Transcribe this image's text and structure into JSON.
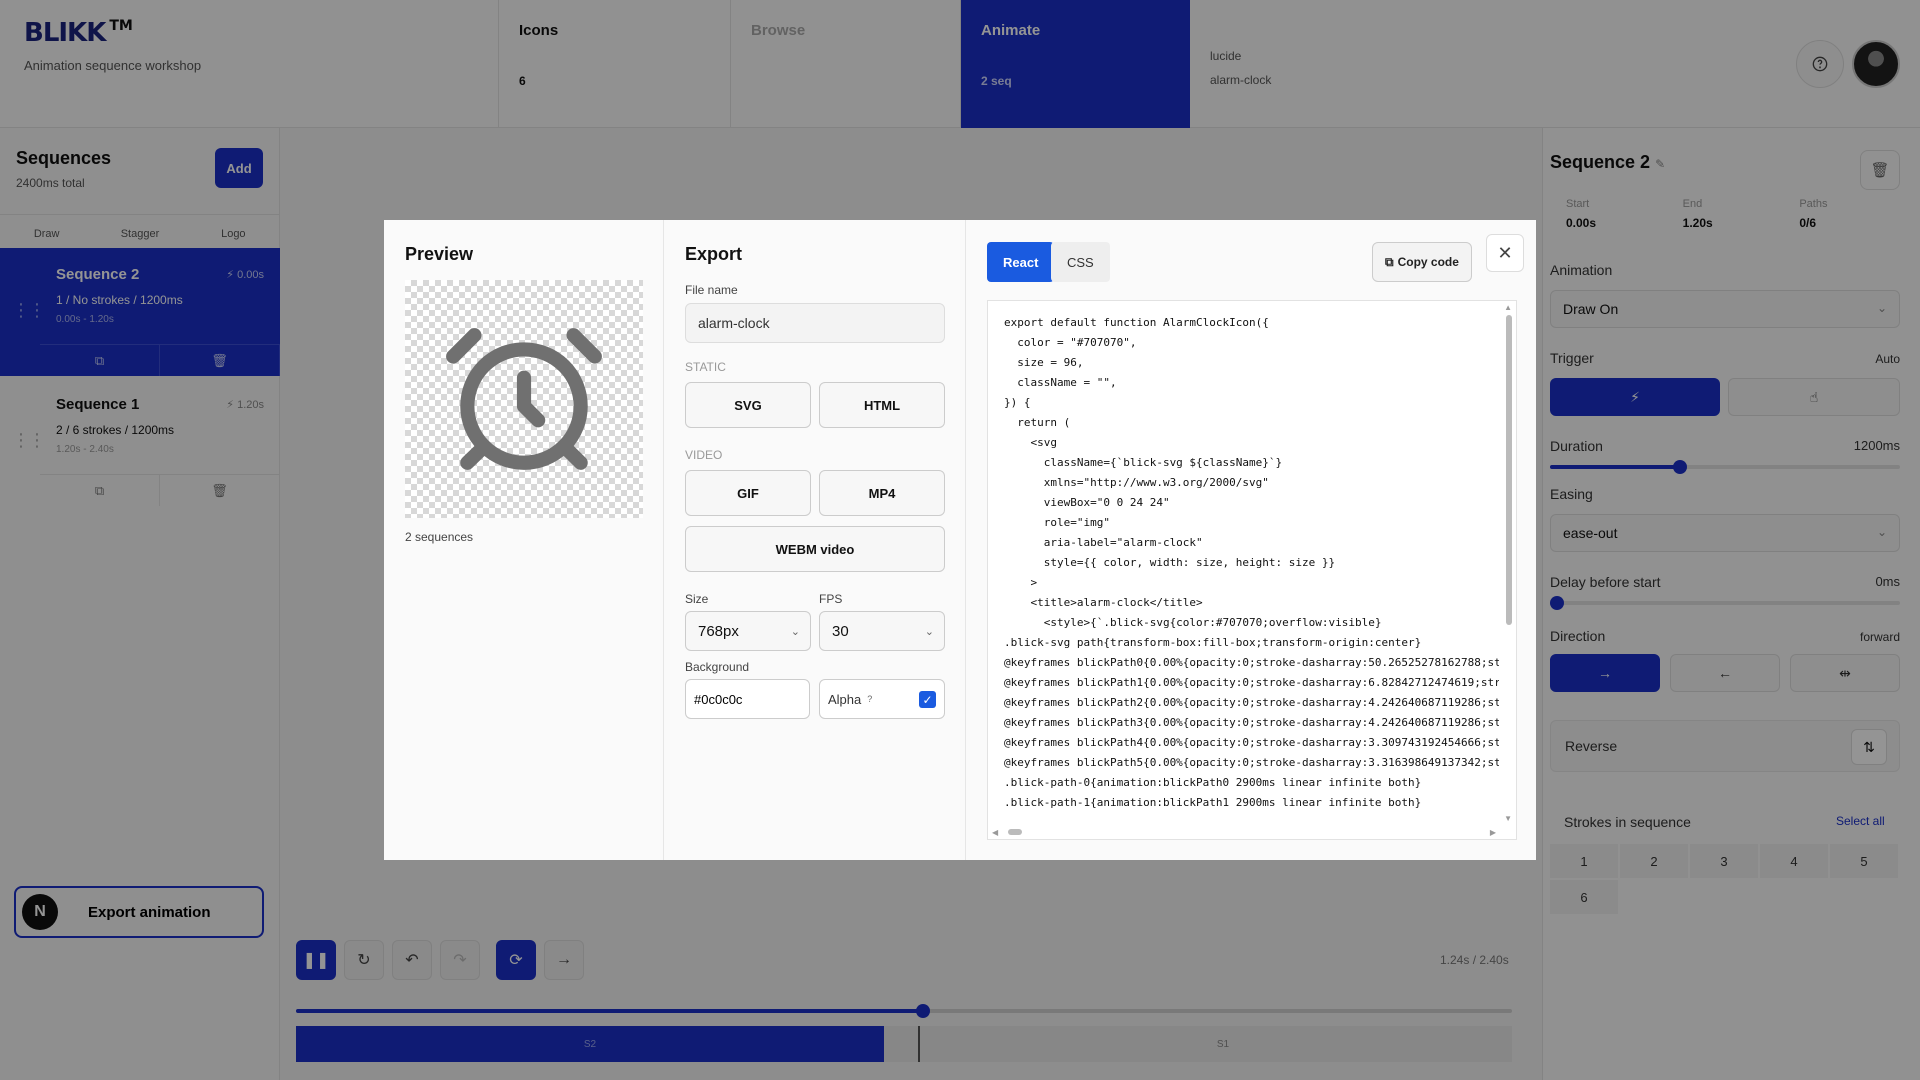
{
  "app": {
    "logo": "BLIKK",
    "trademark": "TM",
    "tagline": "Animation sequence workshop"
  },
  "top_tabs": [
    {
      "label": "Icons",
      "sub": "6"
    },
    {
      "label": "Browse",
      "sub": ""
    },
    {
      "label": "Animate",
      "sub": "2 seq"
    }
  ],
  "icon_meta": {
    "library": "lucide",
    "name": "alarm-clock"
  },
  "sidebar": {
    "title": "Sequences",
    "total": "2400ms total",
    "add_label": "Add",
    "modes": [
      "Draw",
      "Stagger",
      "Logo"
    ],
    "sequences": [
      {
        "name": "Sequence 2",
        "start": "0.00s",
        "info": "1 / No strokes / 1200ms",
        "range": "0.00s - 1.20s",
        "active": true
      },
      {
        "name": "Sequence 1",
        "start": "1.20s",
        "info": "2 / 6 strokes / 1200ms",
        "range": "1.20s - 2.40s",
        "active": false
      }
    ],
    "export_label": "Export animation",
    "export_badge": "N"
  },
  "player": {
    "timecode": "1.24s / 2.40s",
    "progress": 0.516,
    "segments": [
      {
        "label": "S2",
        "fraction": 0.5
      },
      {
        "label": "S1",
        "fraction": 0.5
      }
    ]
  },
  "inspector": {
    "title": "Sequence 2",
    "stats": [
      {
        "label": "Start",
        "value": "0.00s"
      },
      {
        "label": "End",
        "value": "1.20s"
      },
      {
        "label": "Paths",
        "value": "0/6"
      }
    ],
    "animation_label": "Animation",
    "animation_value": "Draw On",
    "trigger_label": "Trigger",
    "trigger_value": "Auto",
    "duration_label": "Duration",
    "duration_value": "1200ms",
    "duration_fraction": 0.37,
    "easing_label": "Easing",
    "easing_value": "ease-out",
    "delay_label": "Delay before start",
    "delay_value": "0ms",
    "direction_label": "Direction",
    "direction_value": "forward",
    "reverse_label": "Reverse",
    "strokes_label": "Strokes in sequence",
    "select_all_label": "Select all",
    "strokes": [
      "1",
      "2",
      "3",
      "4",
      "5",
      "6"
    ]
  },
  "modal": {
    "preview_title": "Preview",
    "preview_caption": "2 sequences",
    "icon_color": "#707070",
    "export_title": "Export",
    "file_name_label": "File name",
    "file_name_value": "alarm-clock",
    "static_label": "STATIC",
    "svg_label": "SVG",
    "html_label": "HTML",
    "video_label": "VIDEO",
    "gif_label": "GIF",
    "mp4_label": "MP4",
    "webm_label": "WEBM video",
    "size_label": "Size",
    "size_value": "768px",
    "fps_label": "FPS",
    "fps_value": "30",
    "background_label": "Background",
    "background_value": "#0c0c0c",
    "alpha_label": "Alpha",
    "alpha_help": "?",
    "alpha_checked": true,
    "code_tabs": [
      "React",
      "CSS"
    ],
    "copy_label": "Copy code",
    "code_lines": [
      "export default function AlarmClockIcon({",
      "  color = \"#707070\",",
      "  size = 96,",
      "  className = \"\",",
      "}) {",
      "  return (",
      "    <svg",
      "      className={`blick-svg ${className}`}",
      "      xmlns=\"http://www.w3.org/2000/svg\"",
      "      viewBox=\"0 0 24 24\"",
      "      role=\"img\"",
      "      aria-label=\"alarm-clock\"",
      "      style={{ color, width: size, height: size }}",
      "    >",
      "    <title>alarm-clock</title>",
      "      <style>{`.blick-svg{color:#707070;overflow:visible}",
      ".blick-svg path{transform-box:fill-box;transform-origin:center}",
      "@keyframes blickPath0{0.00%{opacity:0;stroke-dasharray:50.26525278162788;st",
      "@keyframes blickPath1{0.00%{opacity:0;stroke-dasharray:6.82842712474619;str",
      "@keyframes blickPath2{0.00%{opacity:0;stroke-dasharray:4.242640687119286;st",
      "@keyframes blickPath3{0.00%{opacity:0;stroke-dasharray:4.242640687119286;st",
      "@keyframes blickPath4{0.00%{opacity:0;stroke-dasharray:3.309743192454666;st",
      "@keyframes blickPath5{0.00%{opacity:0;stroke-dasharray:3.316398649137342;st",
      ".blick-path-0{animation:blickPath0 2900ms linear infinite both}",
      ".blick-path-1{animation:blickPath1 2900ms linear infinite both}"
    ]
  },
  "colors": {
    "accent": "#1a30c8",
    "modal_accent": "#1a5be0"
  }
}
